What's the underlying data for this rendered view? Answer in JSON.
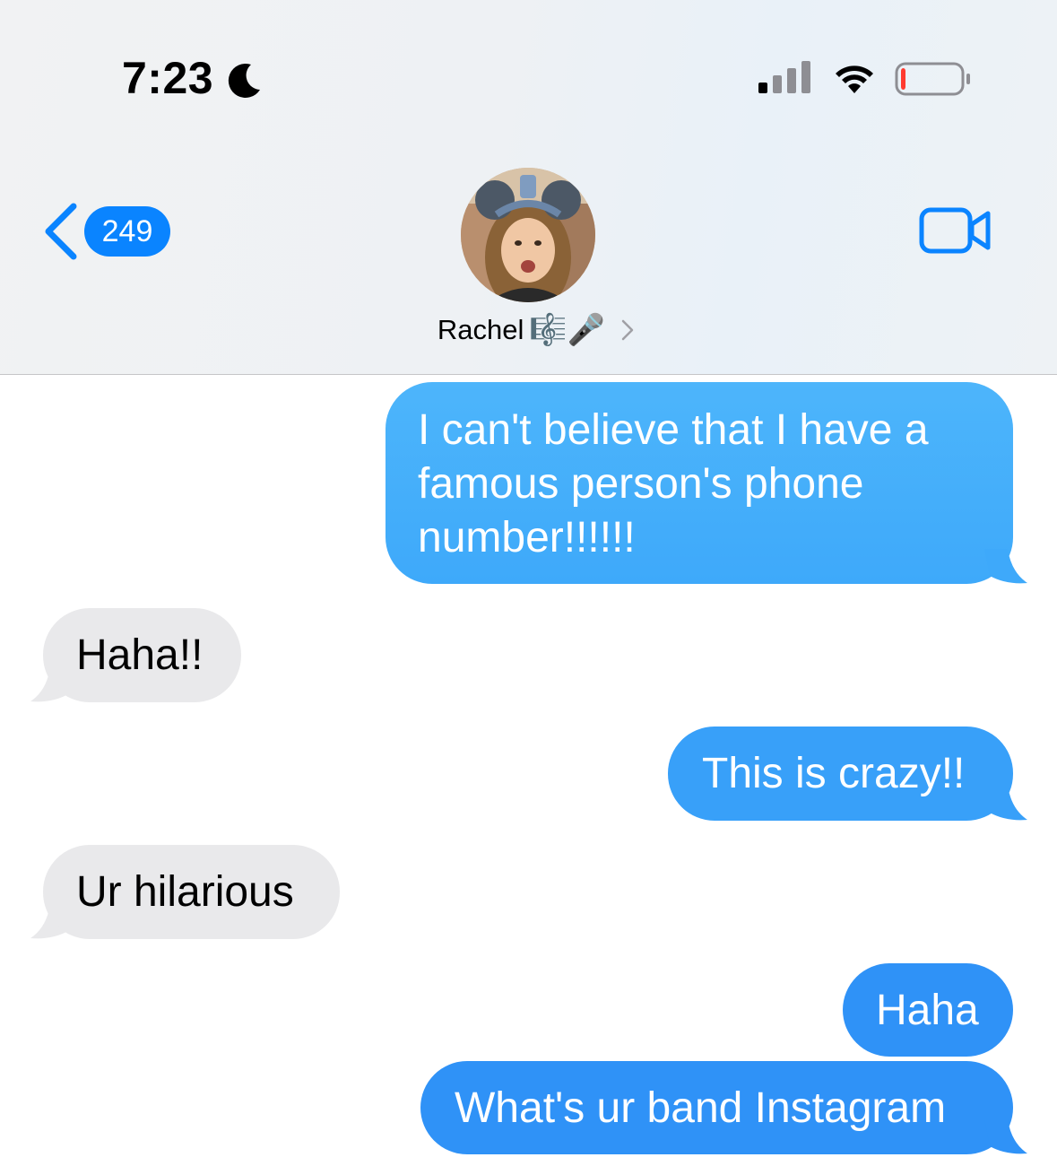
{
  "status_bar": {
    "time": "7:23",
    "focus_icon": "moon-icon",
    "signal_icon": "signal-icon",
    "wifi_icon": "wifi-icon",
    "battery_icon": "battery-icon",
    "battery_level": 0.08,
    "battery_color": "#ff3b30"
  },
  "nav": {
    "back_badge_count": "249",
    "contact_name": "Rachel",
    "contact_emoji": "🎼🎤",
    "video_call_icon": "video-camera-icon"
  },
  "colors": {
    "accent": "#0a84ff",
    "outgoing_bubble": "#39a0f8",
    "incoming_bubble": "#e9e9eb"
  },
  "messages": [
    {
      "direction": "outgoing",
      "lines": [
        " I can't believe that I have a",
        "famous person's phone",
        "number!!!!!!"
      ]
    },
    {
      "direction": "incoming",
      "lines": [
        "Haha!!"
      ]
    },
    {
      "direction": "outgoing",
      "lines": [
        "This is crazy!!"
      ]
    },
    {
      "direction": "incoming",
      "lines": [
        "Ur hilarious"
      ]
    },
    {
      "direction": "outgoing",
      "lines": [
        "Haha"
      ]
    },
    {
      "direction": "outgoing",
      "lines": [
        "What's ur band Instagram"
      ]
    }
  ]
}
